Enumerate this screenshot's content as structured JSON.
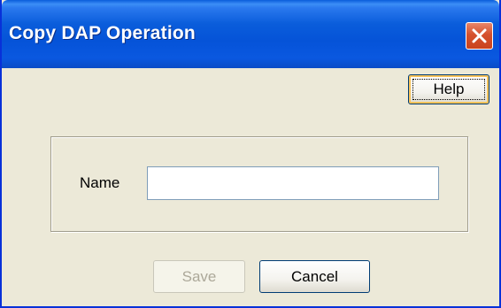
{
  "window": {
    "title": "Copy DAP Operation"
  },
  "toolbar": {
    "help_label": "Help"
  },
  "form": {
    "name_label": "Name",
    "name_value": "",
    "name_placeholder": ""
  },
  "footer": {
    "save_label": "Save",
    "cancel_label": "Cancel"
  },
  "colors": {
    "titlebar": "#0a5ddb",
    "close_button": "#d5512e",
    "dialog_background": "#ece9d8",
    "disabled_text": "#aca899"
  },
  "icons": {
    "close": "close-icon"
  }
}
